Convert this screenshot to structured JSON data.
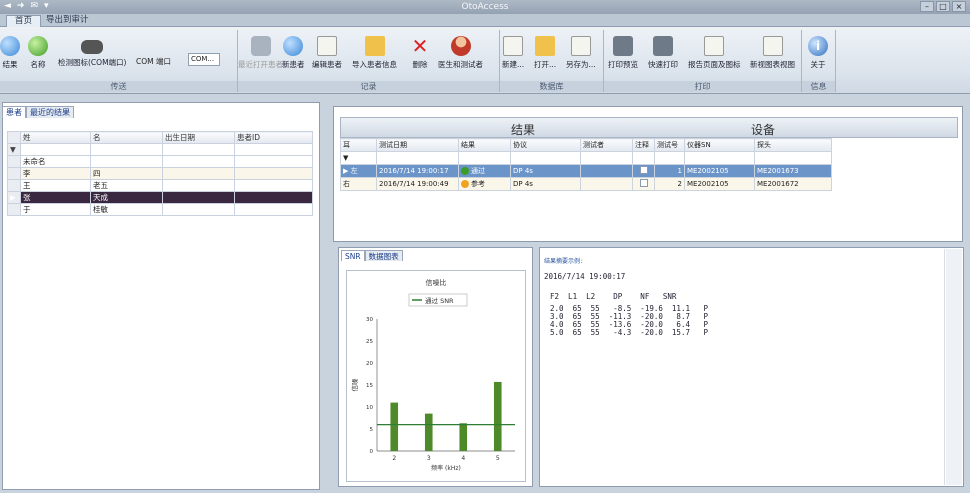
{
  "window": {
    "title": "OtoAccess"
  },
  "quick_access": [
    "◄",
    "➜",
    "✉",
    "▾"
  ],
  "ribbon_tabs": [
    {
      "label": "首页",
      "active": true
    },
    {
      "label": "导出到审计",
      "active": false
    }
  ],
  "ribbon": {
    "groups": [
      "传送",
      "记录",
      "数据库",
      "打印",
      "信息"
    ],
    "buttons": {
      "sync": "结果",
      "name": "名称",
      "detect": "检测图标(COM端口)",
      "com_port_label": "COM 端口",
      "com_port_value": "COM...",
      "new_patient_grayed": "最近打开患者",
      "new_patient": "新患者",
      "edit_patient": "编辑患者",
      "import_patient": "导入患者信息",
      "delete": "删除",
      "doctor_tester": "医生和测试者",
      "new_db": "新建...",
      "open": "打开...",
      "save_as": "另存为...",
      "print_preview": "打印预览",
      "quick_print": "快速打印",
      "report_setup": "报告页面及图标",
      "new_view": "新视图表视图",
      "about": "关于"
    }
  },
  "left_tabs": [
    "患者",
    "最近的结果"
  ],
  "patients_table": {
    "headers": [
      "姓",
      "名",
      "出生日期",
      "患者ID"
    ],
    "rows": [
      {
        "last": "未命名",
        "first": "",
        "dob": "",
        "id": ""
      },
      {
        "last": "李",
        "first": "四",
        "dob": "",
        "id": ""
      },
      {
        "last": "王",
        "first": "老五",
        "dob": "",
        "id": ""
      },
      {
        "last": "张",
        "first": "天成",
        "dob": "",
        "id": ""
      },
      {
        "last": "于",
        "first": "桂敏",
        "dob": "",
        "id": ""
      }
    ],
    "selected_index": 3
  },
  "results": {
    "group_left": "结果",
    "group_right": "设备",
    "headers": [
      "耳",
      "测试日期",
      "结果",
      "协议",
      "测试者",
      "注释",
      "测试号",
      "仪器SN",
      "探头"
    ],
    "rows": [
      {
        "ear": "左",
        "date": "2016/7/14 19:00:17",
        "result": "通过",
        "result_status": "pass",
        "protocol": "DP 4s",
        "tester": "",
        "note": true,
        "test_no": "1",
        "sn": "ME2002105",
        "probe": "ME2001673"
      },
      {
        "ear": "右",
        "date": "2016/7/14 19:00:49",
        "result": "参考",
        "result_status": "refer",
        "protocol": "DP 4s",
        "tester": "",
        "note": true,
        "test_no": "2",
        "sn": "ME2002105",
        "probe": "ME2001672"
      }
    ]
  },
  "chart_tabs": [
    "SNR",
    "数据图表"
  ],
  "chart_data": {
    "type": "bar",
    "title": "信噪比",
    "legend": "通过 SNR",
    "xlabel": "频率 (kHz)",
    "ylabel": "信噪",
    "categories": [
      "2",
      "3",
      "4",
      "5"
    ],
    "values": [
      11,
      8.5,
      6.3,
      15.7
    ],
    "pass_line": 6,
    "ylim": [
      0,
      30
    ],
    "yticks": [
      0,
      5,
      10,
      15,
      20,
      25,
      30
    ],
    "grid": false,
    "colors": {
      "bar": "#4f8a2a",
      "pass_line": "#2e7d32"
    }
  },
  "test_detail": {
    "heading": "结果摘要示例:",
    "timestamp": "2016/7/14 19:00:17",
    "columns": "F2  L1  L2    DP    NF   SNR",
    "lines": [
      "2.0  65  55   -8.5  -19.6  11.1   P",
      "3.0  65  55  -11.3  -20.0   8.7   P",
      "4.0  65  55  -13.6  -20.0   6.4   P",
      "5.0  65  55   -4.3  -20.0  15.7   P"
    ]
  }
}
